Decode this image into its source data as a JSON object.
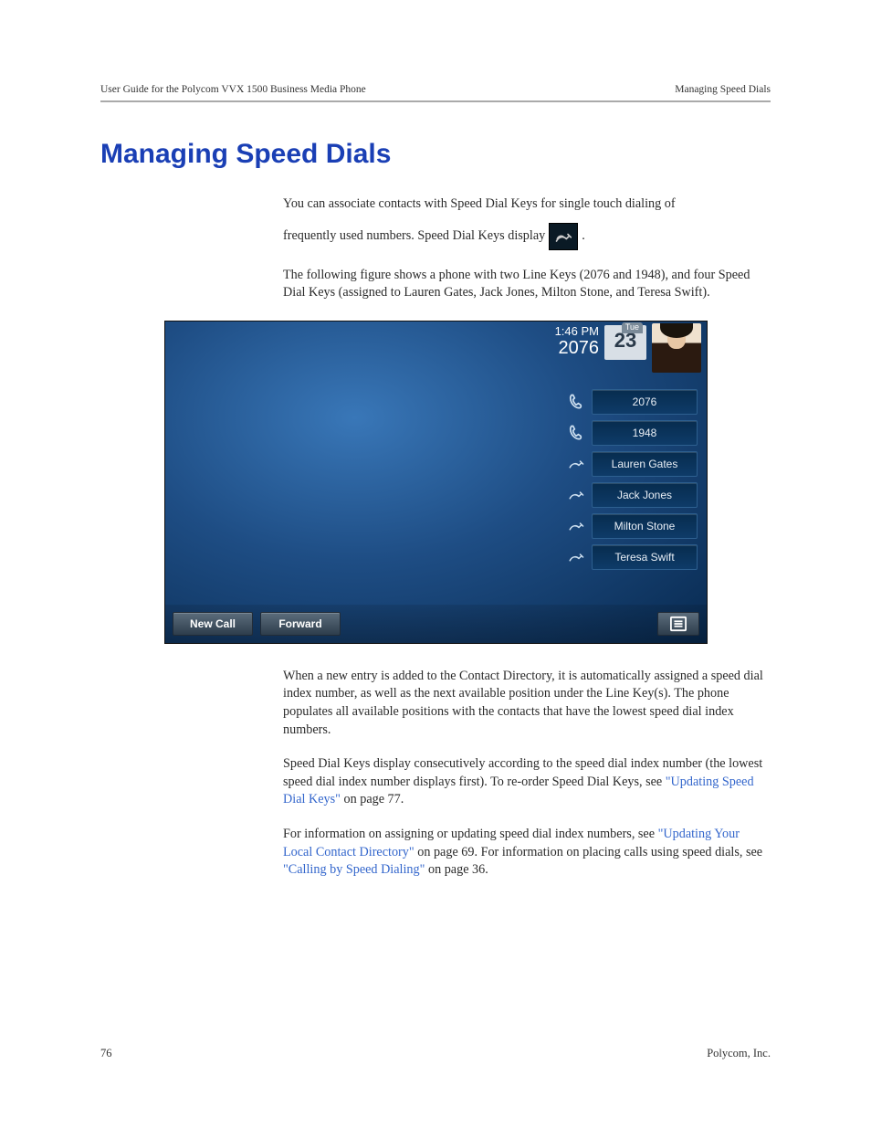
{
  "header": {
    "left": "User Guide for the Polycom VVX 1500 Business Media Phone",
    "right": "Managing Speed Dials"
  },
  "title": "Managing Speed Dials",
  "p1a": "You can associate contacts with Speed Dial Keys for single touch dialing of",
  "p1b": "frequently used numbers. Speed Dial Keys display",
  "p1c": ".",
  "p2": "The following figure shows a phone with two Line Keys (2076 and 1948), and four Speed Dial Keys (assigned to Lauren Gates, Jack Jones, Milton Stone, and Teresa Swift).",
  "phone": {
    "time": "1:46 PM",
    "extension": "2076",
    "day": "Tue",
    "date": "23",
    "line_keys": [
      {
        "label": "2076",
        "type": "line"
      },
      {
        "label": "1948",
        "type": "line"
      },
      {
        "label": "Lauren Gates",
        "type": "speed"
      },
      {
        "label": "Jack Jones",
        "type": "speed"
      },
      {
        "label": "Milton Stone",
        "type": "speed"
      },
      {
        "label": "Teresa Swift",
        "type": "speed"
      }
    ],
    "softkeys": {
      "new_call": "New Call",
      "forward": "Forward"
    }
  },
  "p3": "When a new entry is added to the Contact Directory, it is automatically assigned a speed dial index number, as well as the next available position under the Line Key(s). The phone populates all available positions with the contacts that have the lowest speed dial index numbers.",
  "p4a": "Speed Dial Keys display consecutively according to the speed dial index number (the lowest speed dial index number displays first). To re-order Speed Dial Keys, see ",
  "p4_link": "\"Updating Speed Dial Keys\"",
  "p4b": " on page 77.",
  "p5a": "For information on assigning or updating speed dial index numbers, see ",
  "p5_link1": "\"Updating Your Local Contact Directory\"",
  "p5b": " on page 69. For information on placing calls using speed dials, see ",
  "p5_link2": "\"Calling by Speed Dialing\"",
  "p5c": " on page 36.",
  "footer": {
    "page": "76",
    "company": "Polycom, Inc."
  }
}
